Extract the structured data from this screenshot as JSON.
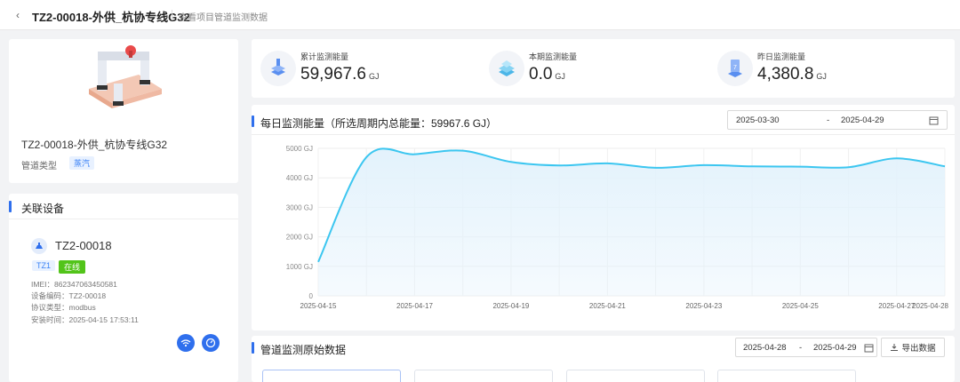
{
  "header": {
    "back_symbol": "‹",
    "title": "TZ2-00018-外供_杭协专线G32",
    "subtitle": "查看项目管道监测数据"
  },
  "pipe": {
    "name": "TZ2-00018-外供_杭协专线G32",
    "type_label": "管道类型",
    "type_value": "蒸汽"
  },
  "devices": {
    "section_title": "关联设备",
    "item": {
      "name": "TZ2-00018",
      "badge_type": "TZ1",
      "badge_status": "在线",
      "imei": "IMEI：862347063450581",
      "code": "设备编码：TZ2-00018",
      "protocol": "协议类型：modbus",
      "install_time": "安装时间：2025-04-15 17:53:11"
    }
  },
  "stats": [
    {
      "label": "累计监测能量",
      "value": "59,967.6",
      "unit": "GJ",
      "icon": "stack-icon"
    },
    {
      "label": "本期监测能量",
      "value": "0.0",
      "unit": "GJ",
      "icon": "layers-icon"
    },
    {
      "label": "昨日监测能量",
      "value": "4,380.8",
      "unit": "GJ",
      "icon": "calendar-icon"
    }
  ],
  "chart_section": {
    "title": "每日监测能量（所选周期内总能量：59967.6 GJ）",
    "date_start": "2025-03-30",
    "date_sep": "-",
    "date_end": "2025-04-29"
  },
  "chart_data": {
    "type": "area",
    "x": [
      "2025-04-15",
      "2025-04-16",
      "2025-04-17",
      "2025-04-18",
      "2025-04-19",
      "2025-04-20",
      "2025-04-21",
      "2025-04-22",
      "2025-04-23",
      "2025-04-24",
      "2025-04-25",
      "2025-04-26",
      "2025-04-27",
      "2025-04-28"
    ],
    "values": [
      1150,
      4700,
      4800,
      4920,
      4540,
      4420,
      4490,
      4340,
      4430,
      4390,
      4380,
      4360,
      4660,
      4390
    ],
    "y_ticks": [
      "0",
      "1000 GJ",
      "2000 GJ",
      "3000 GJ",
      "4000 GJ",
      "5000 GJ"
    ],
    "x_ticks": [
      "2025-04-15",
      "2025-04-17",
      "2025-04-19",
      "2025-04-21",
      "2025-04-23",
      "2025-04-25",
      "2025-04-27",
      "2025-04-28"
    ],
    "ylim": [
      0,
      5000
    ],
    "grid": true,
    "line_color": "#3cc6f0",
    "fill_color": "#e3f2fc"
  },
  "raw_section": {
    "title": "管道监测原始数据",
    "date_start": "2025-04-28",
    "date_sep": "-",
    "date_end": "2025-04-29",
    "export_label": "导出数据"
  },
  "colors": {
    "accent": "#2f6fed",
    "online": "#52c41a",
    "tag_bg": "#e8f1ff"
  }
}
